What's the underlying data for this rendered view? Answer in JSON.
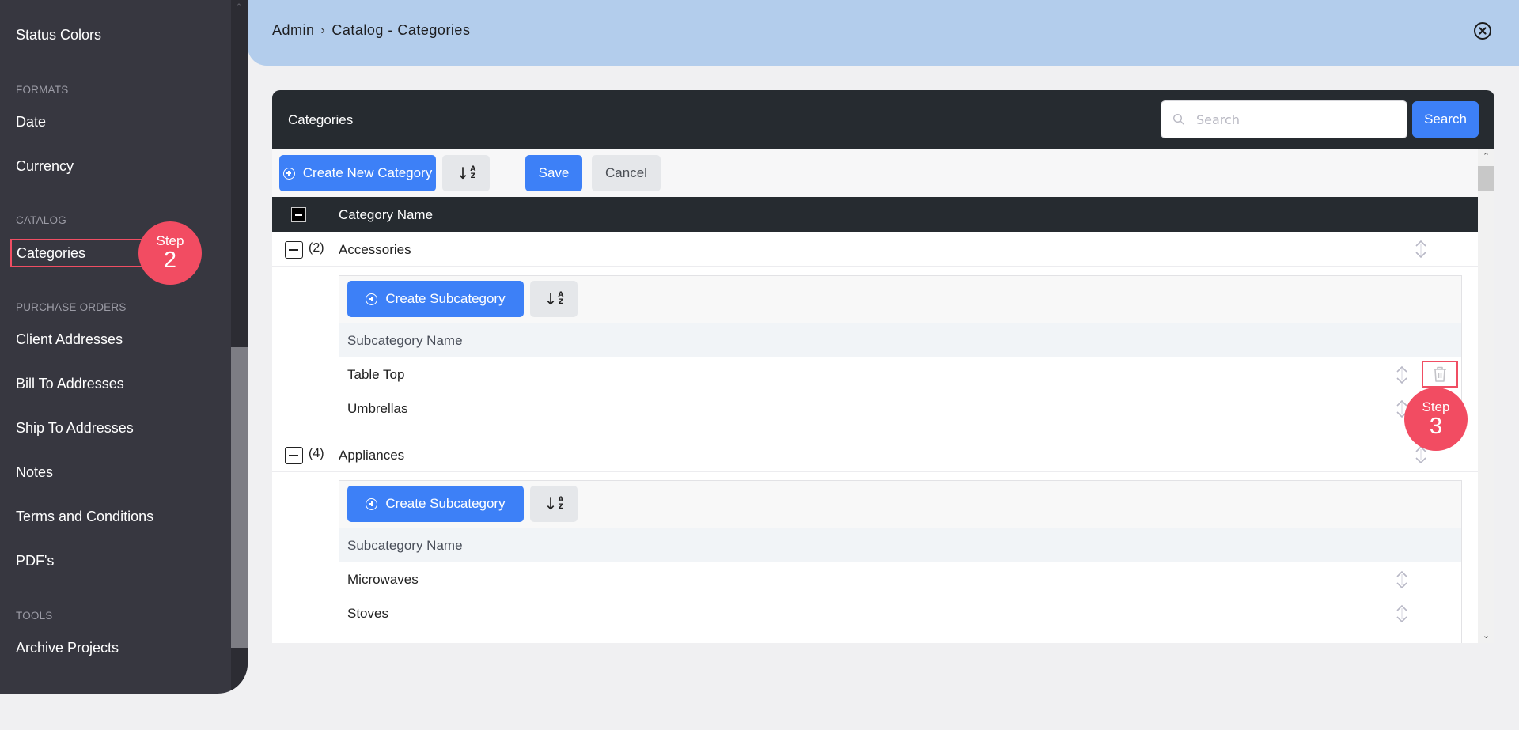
{
  "sidebar": {
    "items": [
      {
        "type": "item",
        "label": "Status Colors"
      },
      {
        "type": "section",
        "label": "FORMATS"
      },
      {
        "type": "item",
        "label": "Date"
      },
      {
        "type": "item",
        "label": "Currency"
      },
      {
        "type": "section",
        "label": "CATALOG"
      },
      {
        "type": "item",
        "label": "Categories",
        "highlighted": true
      },
      {
        "type": "section",
        "label": "PURCHASE ORDERS"
      },
      {
        "type": "item",
        "label": "Client Addresses"
      },
      {
        "type": "item",
        "label": "Bill To Addresses"
      },
      {
        "type": "item",
        "label": "Ship To Addresses"
      },
      {
        "type": "item",
        "label": "Notes"
      },
      {
        "type": "item",
        "label": "Terms and Conditions"
      },
      {
        "type": "item",
        "label": "PDF's"
      },
      {
        "type": "section",
        "label": "TOOLS"
      },
      {
        "type": "item",
        "label": "Archive Projects"
      }
    ]
  },
  "steps": {
    "step2": {
      "label": "Step",
      "number": "2"
    },
    "step3": {
      "label": "Step",
      "number": "3"
    }
  },
  "header": {
    "breadcrumb_root": "Admin",
    "breadcrumb_separator": "›",
    "breadcrumb_page": "Catalog - Categories",
    "close_icon": "close-circle-icon"
  },
  "card": {
    "title": "Categories",
    "search_placeholder": "Search",
    "search_value": "",
    "search_button": "Search",
    "toolbar": {
      "create_label": "Create New Category",
      "sort_icon": "sort-az-icon",
      "save_label": "Save",
      "cancel_label": "Cancel"
    },
    "column_header": "Category Name",
    "categories": [
      {
        "count": "(2)",
        "name": "Accessories",
        "create_sub_label": "Create Subcategory",
        "sub_header": "Subcategory Name",
        "subcategories": [
          "Table Top",
          "Umbrellas"
        ]
      },
      {
        "count": "(4)",
        "name": "Appliances",
        "create_sub_label": "Create Subcategory",
        "sub_header": "Subcategory Name",
        "subcategories": [
          "Microwaves",
          "Stoves"
        ]
      }
    ]
  },
  "colors": {
    "primary": "#3d80f7",
    "sidebar_bg": "#373740",
    "header_bg": "#b3cdec",
    "table_dark": "#262b30",
    "step_badge": "#f24c62"
  }
}
